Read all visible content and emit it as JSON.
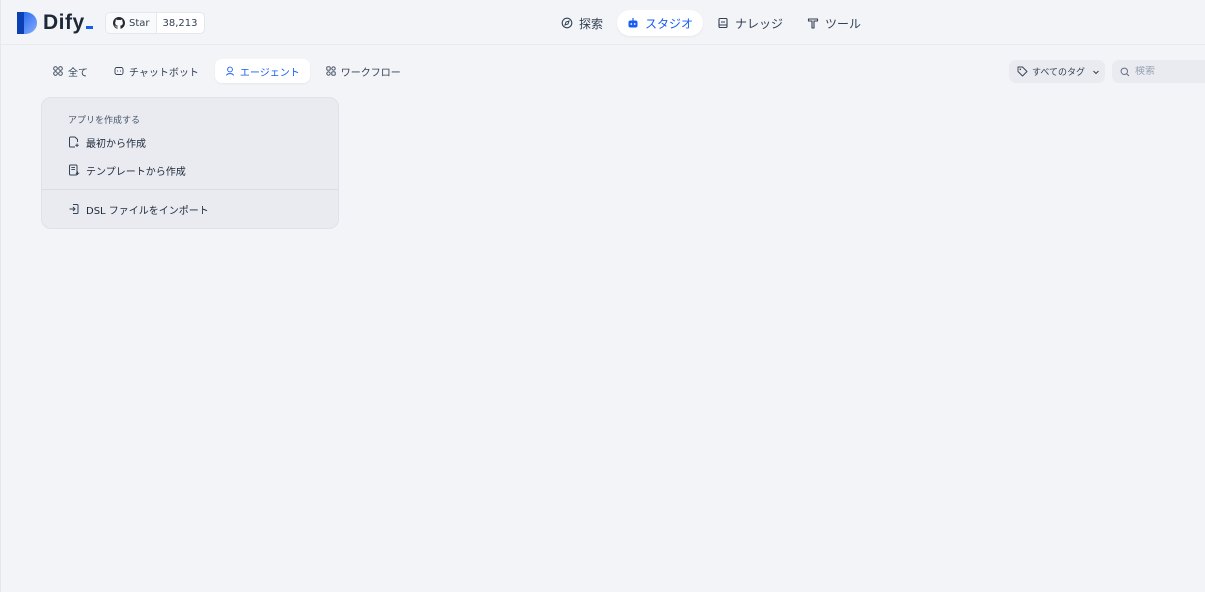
{
  "app": {
    "name": "Dify",
    "github": {
      "star_label": "Star",
      "count": "38,213"
    }
  },
  "nav": [
    {
      "label": "探索",
      "icon": "compass-icon",
      "active": false
    },
    {
      "label": "スタジオ",
      "icon": "robot-icon",
      "active": true
    },
    {
      "label": "ナレッジ",
      "icon": "book-icon",
      "active": false
    },
    {
      "label": "ツール",
      "icon": "tools-icon",
      "active": false
    }
  ],
  "tabs": [
    {
      "label": "全て",
      "icon": "grid-icon",
      "active": false
    },
    {
      "label": "チャットボット",
      "icon": "chat-icon",
      "active": false
    },
    {
      "label": "エージェント",
      "icon": "agent-icon",
      "active": true
    },
    {
      "label": "ワークフロー",
      "icon": "workflow-icon",
      "active": false
    }
  ],
  "filters": {
    "tag_label": "すべてのタグ",
    "search_placeholder": "検索"
  },
  "create_card": {
    "title": "アプリを作成する",
    "items": [
      {
        "label": "最初から作成",
        "icon": "new-file-icon"
      },
      {
        "label": "テンプレートから作成",
        "icon": "template-icon"
      },
      {
        "label": "DSL ファイルをインポート",
        "icon": "import-icon"
      }
    ]
  },
  "colors": {
    "accent": "#155eef",
    "background": "#f2f4f7"
  }
}
